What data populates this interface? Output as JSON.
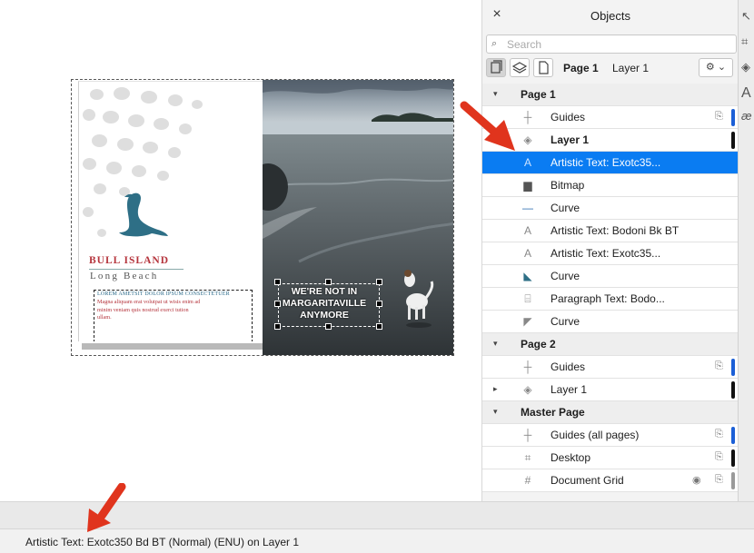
{
  "document": {
    "brand_title": "BULL ISLAND",
    "brand_subtitle": "Long Beach",
    "para_heading": "LOREM AMETSIT DOLOR IPSUM CONSECTETUER",
    "para_body_lines": [
      "Magna aliquam erat volutpat ut wisis enim ad",
      "minim veniam quis nostrud exerci tution",
      "ullam."
    ],
    "overlay_lines": [
      "WE'RE NOT IN",
      "MARGARITAVILLE",
      "ANYMORE"
    ]
  },
  "panel": {
    "title": "Objects",
    "close_symbol": "×",
    "search_placeholder": "Search",
    "toolbar_page": "Page 1",
    "toolbar_layer": "Layer 1",
    "options_symbol": "⚙ ⌄"
  },
  "tree": [
    {
      "kind": "header",
      "label": "Page 1",
      "expander": "▾"
    },
    {
      "kind": "item",
      "label": "Guides",
      "icon": "guides-icon",
      "glyph": "┼",
      "lock": true,
      "bar": "#1b5fd6"
    },
    {
      "kind": "item",
      "label": "Layer 1",
      "icon": "layer-icon",
      "glyph": "◈",
      "bold": true,
      "bar": "#111111"
    },
    {
      "kind": "item",
      "label": "Artistic Text: Exotc35...",
      "icon": "artistic-text-icon",
      "glyph": "A",
      "selected": true
    },
    {
      "kind": "item",
      "label": "Bitmap",
      "icon": "bitmap-icon",
      "glyph": "▆"
    },
    {
      "kind": "item",
      "label": "Curve",
      "icon": "curve-line-icon",
      "glyph": "—"
    },
    {
      "kind": "item",
      "label": "Artistic Text: Bodoni Bk BT",
      "icon": "artistic-text-icon",
      "glyph": "A"
    },
    {
      "kind": "item",
      "label": "Artistic Text: Exotc35...",
      "icon": "artistic-text-icon",
      "glyph": "A"
    },
    {
      "kind": "item",
      "label": "Curve",
      "icon": "seal-curve-icon",
      "glyph": "◣"
    },
    {
      "kind": "item",
      "label": "Paragraph Text: Bodo...",
      "icon": "paragraph-text-icon",
      "glyph": "⌸"
    },
    {
      "kind": "item",
      "label": "Curve",
      "icon": "curve-shape-icon",
      "glyph": "◤"
    },
    {
      "kind": "header",
      "label": "Page 2",
      "expander": "▾"
    },
    {
      "kind": "item",
      "label": "Guides",
      "icon": "guides-icon",
      "glyph": "┼",
      "lock": true,
      "bar": "#1b5fd6"
    },
    {
      "kind": "item",
      "label": "Layer 1",
      "icon": "layer-icon",
      "glyph": "◈",
      "collapsed": true,
      "bar": "#111111"
    },
    {
      "kind": "header",
      "label": "Master Page",
      "expander": "▾"
    },
    {
      "kind": "item",
      "label": "Guides (all pages)",
      "icon": "guides-icon",
      "glyph": "┼",
      "lock": true,
      "bar": "#1b5fd6"
    },
    {
      "kind": "item",
      "label": "Desktop",
      "icon": "desktop-icon",
      "glyph": "⌗",
      "lock": true,
      "bar": "#111111"
    },
    {
      "kind": "item",
      "label": "Document Grid",
      "icon": "grid-icon",
      "glyph": "#",
      "lock": true,
      "eye": true,
      "bar": "#9a9a9a"
    }
  ],
  "status": {
    "text": "Artistic Text: Exotc350 Bd BT (Normal) (ENU) on Layer 1"
  },
  "colors": {
    "selection": "#0a7cf2",
    "brand_red": "#b5343c",
    "seal_teal": "#2e6f86",
    "annotation_arrow": "#e0341d"
  }
}
